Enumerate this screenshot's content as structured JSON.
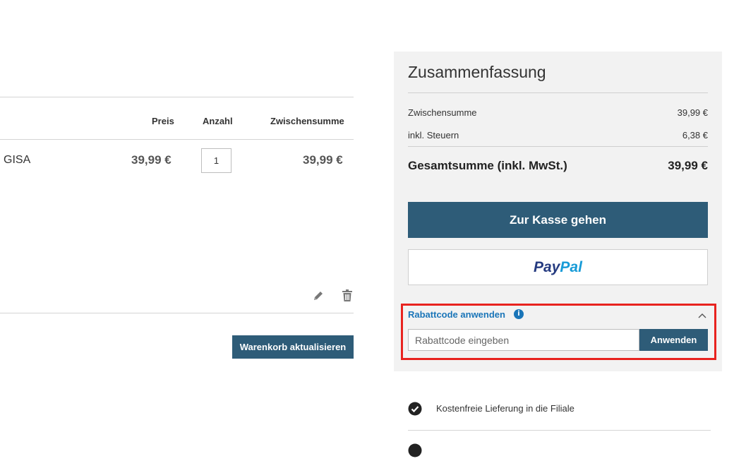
{
  "cart": {
    "headers": {
      "price": "Preis",
      "quantity": "Anzahl",
      "subtotal": "Zwischensumme"
    },
    "item": {
      "name": "GISA",
      "price": "39,99 €",
      "quantity": "1",
      "subtotal": "39,99 €"
    },
    "icons": {
      "edit": "pencil-icon",
      "delete": "trash-icon"
    },
    "update_button": "Warenkorb aktualisieren"
  },
  "summary": {
    "title": "Zusammenfassung",
    "rows": [
      {
        "label": "Zwischensumme",
        "value": "39,99 €"
      },
      {
        "label": "inkl. Steuern",
        "value": "6,38 €"
      }
    ],
    "total": {
      "label": "Gesamtsumme (inkl. MwSt.)",
      "value": "39,99 €"
    },
    "checkout_button": "Zur Kasse gehen",
    "paypal": {
      "part1": "Pay",
      "part2": "Pal"
    },
    "coupon": {
      "title": "Rabattcode anwenden",
      "info_glyph": "i",
      "input_placeholder": "Rabattcode eingeben",
      "input_value": "",
      "apply_button": "Anwenden"
    }
  },
  "benefits": [
    {
      "icon": "check-circle-icon",
      "text": "Kostenfreie Lieferung in die Filiale"
    }
  ],
  "colors": {
    "primary": "#2e5c78",
    "link": "#1a75b8",
    "highlight": "#e8231f",
    "panel": "#f2f2f2",
    "paypal_dark": "#253b80",
    "paypal_light": "#179bd7"
  }
}
